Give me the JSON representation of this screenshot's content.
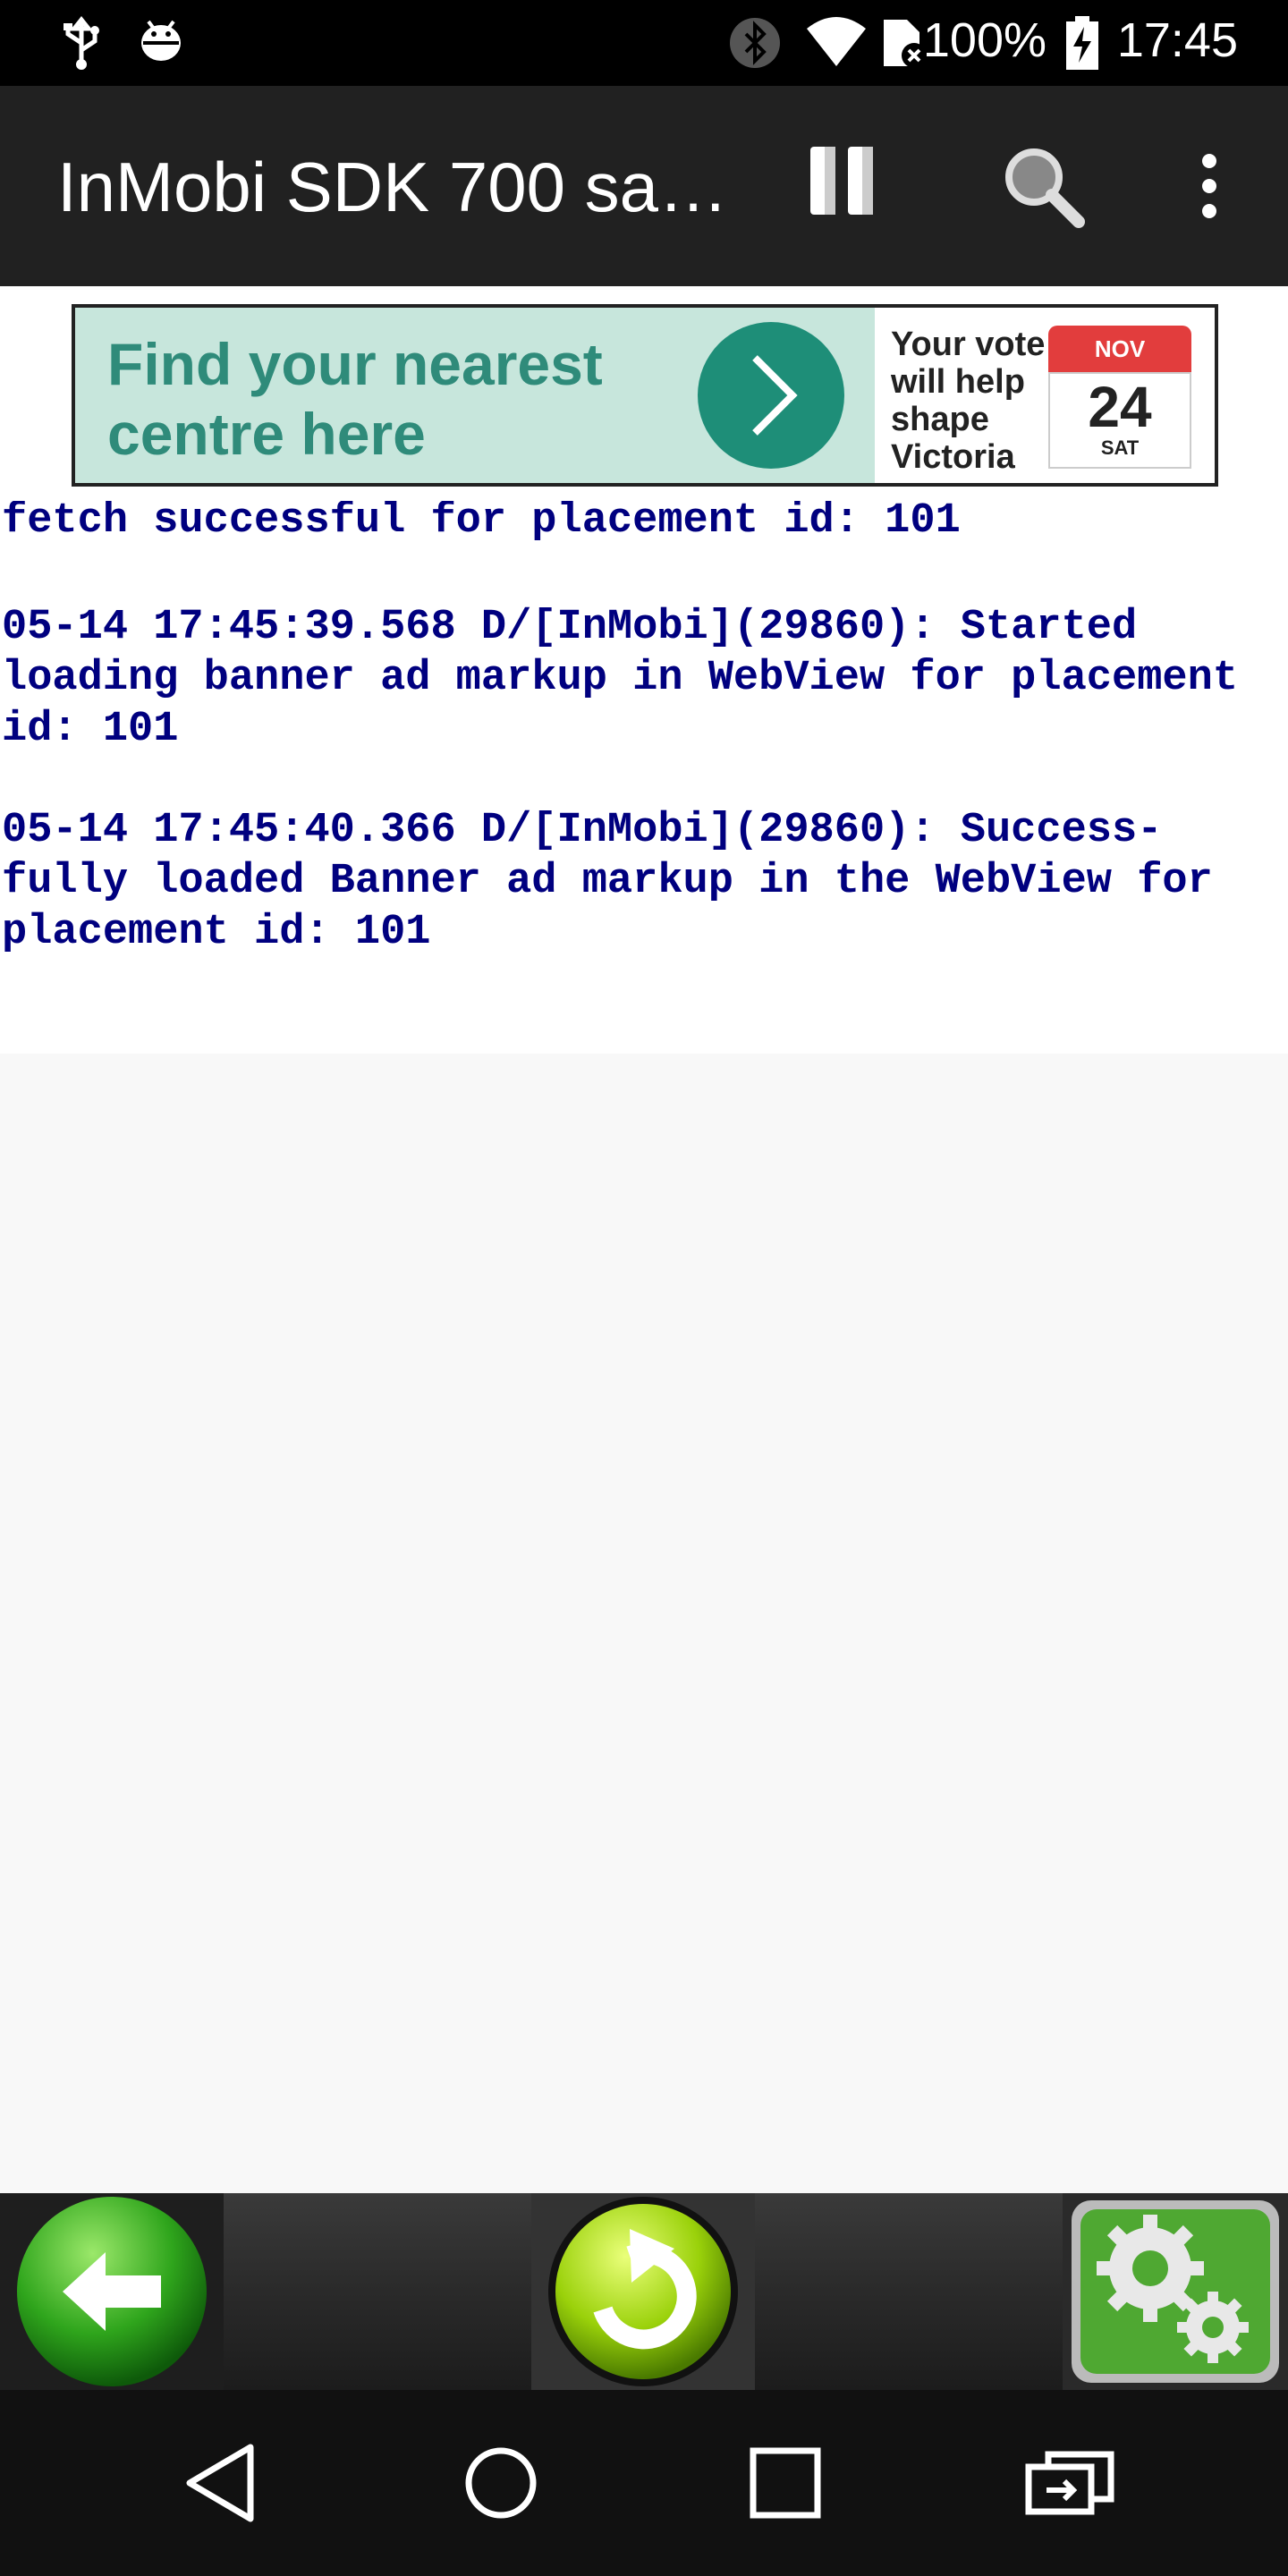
{
  "status_bar": {
    "battery_percent": "100%",
    "time": "17:45",
    "icons": [
      "usb-icon",
      "android-debug-icon",
      "bluetooth-icon",
      "wifi-icon",
      "sim-off-icon",
      "battery-charging-icon"
    ]
  },
  "app_bar": {
    "title": "InMobi SDK 700 sa…",
    "actions": [
      "pause-icon",
      "search-icon",
      "overflow-menu-icon"
    ]
  },
  "ad_banner": {
    "headline_line1": "Find your nearest",
    "headline_line2": "centre here",
    "vote_line1": "Your vote",
    "vote_line2": "will help",
    "vote_line3": "shape",
    "vote_line4": "Victoria",
    "calendar_month": "NOV",
    "calendar_day": "24",
    "calendar_weekday": "SAT",
    "colors": {
      "background": "#c7e6dc",
      "button": "#1e8e78",
      "headline": "#2f8b7a",
      "calendar": "#e23d3d"
    }
  },
  "log": {
    "text_color": "#00007f",
    "entries": [
      "fetch successful for placement id: 101",
      "05-14 17:45:39.568 D/[InMobi](29860): Started\nloading banner ad markup in WebView for placement\nid: 101",
      "05-14 17:45:40.366 D/[InMobi](29860): Success-\nfully loaded Banner ad markup in the WebView for\nplacement id: 101"
    ]
  },
  "toolbar": {
    "buttons": [
      "back-arrow-icon",
      "refresh-icon",
      "settings-gears-icon"
    ]
  },
  "nav_bar": {
    "buttons": [
      "nav-back-icon",
      "nav-home-icon",
      "nav-recents-icon",
      "screen-rotate-icon"
    ]
  }
}
